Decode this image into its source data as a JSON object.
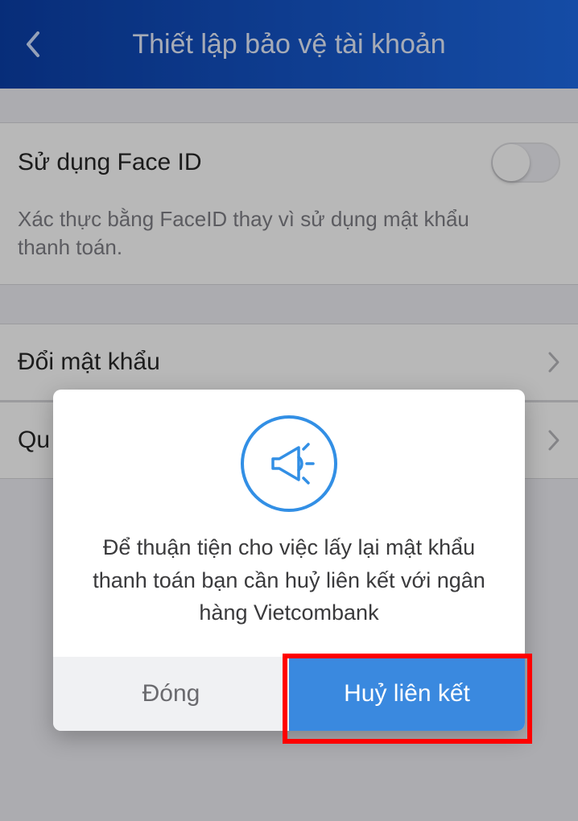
{
  "header": {
    "title": "Thiết lập bảo vệ tài khoản"
  },
  "faceid": {
    "label": "Sử dụng Face ID",
    "description": "Xác thực bằng FaceID thay vì sử dụng mật khẩu thanh toán."
  },
  "rows": {
    "change_password": "Đổi mật khẩu",
    "forgot_prefix": "Qu"
  },
  "modal": {
    "message": "Để thuận tiện cho việc lấy lại mật khẩu thanh toán bạn cần huỷ liên kết với ngân hàng Vietcombank",
    "close_label": "Đóng",
    "unlink_label": "Huỷ liên kết"
  }
}
